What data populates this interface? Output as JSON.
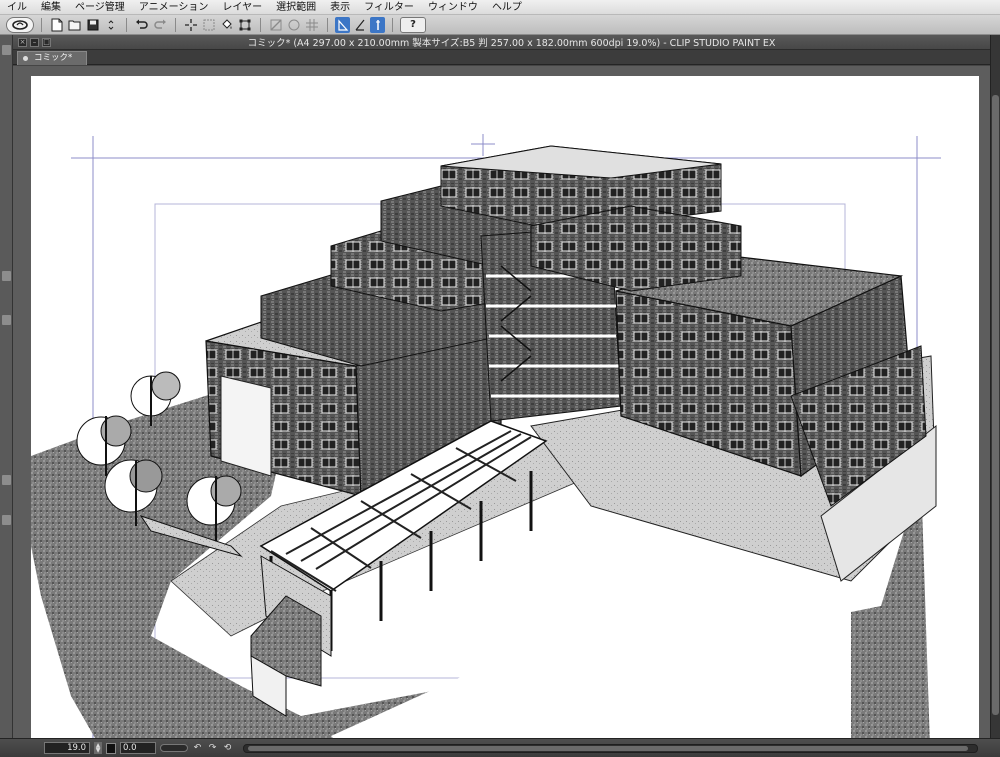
{
  "menubar": {
    "items": [
      "イル",
      "編集",
      "ページ管理",
      "アニメーション",
      "レイヤー",
      "選択範囲",
      "表示",
      "フィルター",
      "ウィンドウ",
      "ヘルプ"
    ]
  },
  "toolbar": {
    "icons": [
      "app-logo-icon",
      "new-file-icon",
      "open-file-icon",
      "save-icon",
      "undo-icon",
      "redo-icon",
      "transform-icon",
      "select-icon",
      "fill-icon",
      "ruler-icon",
      "snap-special-ruler-icon",
      "snap-grid-icon",
      "help-icon"
    ],
    "help_label": "?"
  },
  "window": {
    "title": "コミック* (A4 297.00 x 210.00mm 製本サイズ:B5 判 257.00 x 182.00mm 600dpi 19.0%)  - CLIP STUDIO PAINT EX",
    "tab_label": "コミック*"
  },
  "status": {
    "zoom": "19.0",
    "angle": "0.0"
  },
  "colors": {
    "ui_dark": "#454545",
    "canvas_bg": "#5d5d5d",
    "page": "#ffffff",
    "guide_line": "#8c8cc8",
    "accent_blue": "#3c76c6"
  }
}
